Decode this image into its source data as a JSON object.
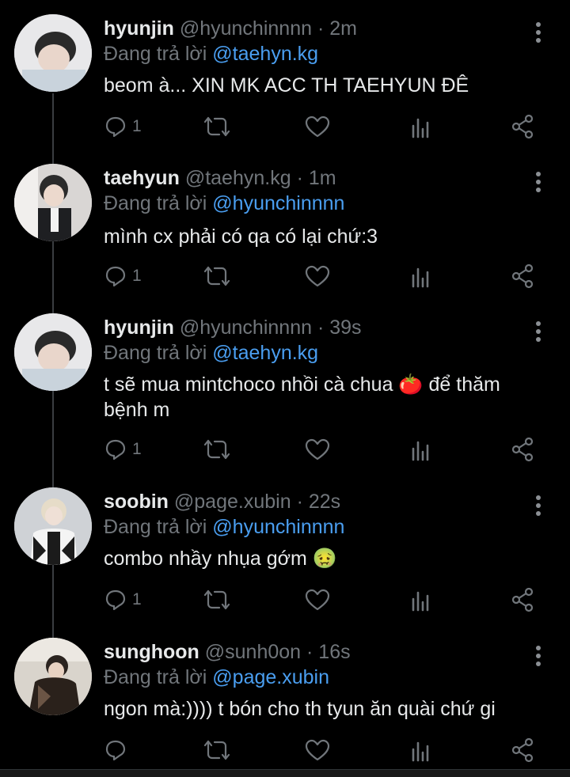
{
  "reply_prefix": "Đang trả lời",
  "tweets": [
    {
      "name": "hyunjin",
      "handle": "@hyunchinnnn",
      "time": "· 2m",
      "reply_to": "@taehyn.kg",
      "text": "beom à... XIN MK ACC TH TAEHYUN ĐÊ",
      "reply_count": "1"
    },
    {
      "name": "taehyun",
      "handle": "@taehyn.kg",
      "time": "· 1m",
      "reply_to": "@hyunchinnnn",
      "text": "mình cx phải có qa có lại chứ:3",
      "reply_count": "1"
    },
    {
      "name": "hyunjin",
      "handle": "@hyunchinnnn",
      "time": "· 39s",
      "reply_to": "@taehyn.kg",
      "text": "t sẽ mua mintchoco nhồi cà chua 🍅 để thăm bệnh m",
      "reply_count": "1"
    },
    {
      "name": "soobin",
      "handle": "@page.xubin",
      "time": "· 22s",
      "reply_to": "@hyunchinnnn",
      "text": "combo nhầy nhụa gớm 🤢",
      "reply_count": "1"
    },
    {
      "name": "sunghoon",
      "handle": "@sunh0on",
      "time": "· 16s",
      "reply_to": "@page.xubin",
      "text": "ngon mà:)))) t bón cho th tyun ăn quài chứ gi",
      "reply_count": ""
    }
  ],
  "icons": [
    "reply-icon",
    "retweet-icon",
    "like-icon",
    "views-icon",
    "share-icon",
    "more-icon"
  ],
  "colors": {
    "background": "#000000",
    "text": "#e7e9ea",
    "muted": "#71767b",
    "mention": "#4a9ef0"
  }
}
